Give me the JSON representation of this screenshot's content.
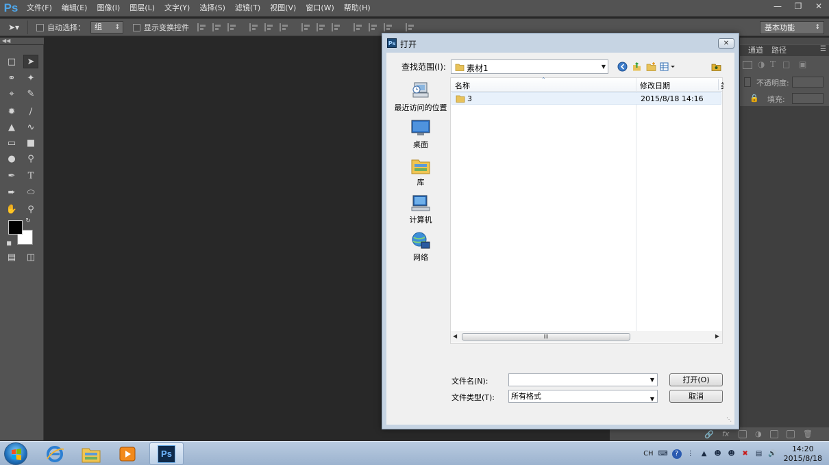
{
  "app": {
    "logo": "Ps"
  },
  "menu": [
    "文件(F)",
    "编辑(E)",
    "图像(I)",
    "图层(L)",
    "文字(Y)",
    "选择(S)",
    "滤镜(T)",
    "视图(V)",
    "窗口(W)",
    "帮助(H)"
  ],
  "options": {
    "auto_select_label": "自动选择：",
    "auto_select_value": "组",
    "show_transform_label": "显示变换控件",
    "workspace": "基本功能"
  },
  "right_panel": {
    "tabs": [
      "通道",
      "路径"
    ],
    "opacity_label": "不透明度:",
    "fill_label": "填充:"
  },
  "dialog": {
    "title": "打开",
    "close": "✕",
    "look_in_label": "查找范围(I):",
    "look_in_value": "素材1",
    "places": [
      "最近访问的位置",
      "桌面",
      "库",
      "计算机",
      "网络"
    ],
    "columns": {
      "name": "名称",
      "date": "修改日期",
      "extra": "类"
    },
    "files": [
      {
        "name": "3",
        "date": "2015/8/18 14:16"
      }
    ],
    "scroll_grip": "III",
    "filename_label": "文件名(N):",
    "filename_value": "",
    "filetype_label": "文件类型(T):",
    "filetype_value": "所有格式",
    "open_button": "打开(O)",
    "cancel_button": "取消"
  },
  "taskbar": {
    "ime": "CH",
    "time": "14:20",
    "date": "2015/8/18"
  },
  "colors": {
    "ps_bg": "#282828",
    "ps_panel": "#535353",
    "ps_blue": "#4fa6e9",
    "dialog_frame": "#c6d4e3",
    "taskbar": "#9cb3cf"
  }
}
